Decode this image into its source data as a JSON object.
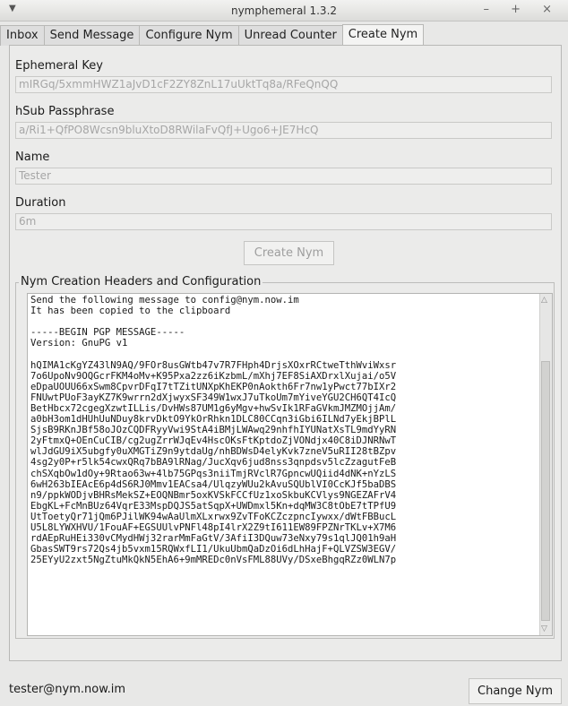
{
  "window": {
    "title": "nymphemeral 1.3.2",
    "menu_icon": "triangle-down-icon",
    "controls": "– + ×"
  },
  "tabs": [
    {
      "label": "Inbox",
      "active": false
    },
    {
      "label": "Send Message",
      "active": false
    },
    {
      "label": "Configure Nym",
      "active": false
    },
    {
      "label": "Unread Counter",
      "active": false
    },
    {
      "label": "Create Nym",
      "active": true
    }
  ],
  "form": {
    "ephemeral_key": {
      "label": "Ephemeral Key",
      "value": "mIRGq/5xmmHWZ1aJvD1cF2ZY8ZnL17uUktTq8a/RFeQnQQ"
    },
    "hsub_passphrase": {
      "label": "hSub Passphrase",
      "value": "a/Ri1+QfPO8Wcsn9bluXtoD8RWilaFvQfJ+Ugo6+JE7HcQ"
    },
    "name": {
      "label": "Name",
      "value": "Tester"
    },
    "duration": {
      "label": "Duration",
      "value": "6m"
    },
    "create_button": "Create Nym"
  },
  "output": {
    "group_title": "Nym Creation Headers and Configuration",
    "text": "Send the following message to config@nym.now.im\nIt has been copied to the clipboard\n\n-----BEGIN PGP MESSAGE-----\nVersion: GnuPG v1\n\nhQIMA1cKgYZ43lN9AQ/9FOr8usGWtb47v7R7FHph4DrjsXOxrRCtweTthWviWxsr\n7o6UpoNv9OQGcrFKM4oMv+K95Pxa2zz6iKzbmL/mXhj7EF8SiAXDrxlXujai/o5V\neDpaUOUU66xSwm8CpvrDFqI7tTZitUNXpKhEKP0nAokth6Fr7nw1yPwct77bIXr2\nFNUwtPUoF3ayKZ7K9wrrn2dXjwyxSF349W1wxJ7uTkoUm7mYiveYGU2CH6QT4IcQ\nBetHbcx72cgegXzwtILLis/DvHWs87UM1g6yMgv+hwSvIk1RFaGVkmJMZMOjjAm/\na0bH3om1dHUhUuNDuy8krvDktO9YkOrRhkn1DLC80CCqn3iGbi6ILNd7yEkjBPlL\nSjsB9RKnJBf58oJOzCQDFRyyVwi9StA4iBMjLWAwq29nhfhIYUNatXsTL9mdYyRN\n2yFtmxQ+OEnCuCIB/cg2ugZrrWJqEv4HscOKsFtKptdoZjVONdjx40C8iDJNRNwT\nwlJdGU9iX5ubgfy0uXMGTiZ9n9ytdaUg/nhBDWsD4elyKvk7zneV5uRII28tBZpv\n4sg2y0P+r5lk54cwxQRq7bBA9lRNag/JucXqv6jud8nss3qnpdsv5lcZzagutFeB\nchSXqbOw1dOy+9Rtao63w+4lb75GPqs3niiTmjRVclR7GpncwUQiid4dNK+nYzLS\n6wH263bIEAcE6p4dS6RJ0Mmv1EACsa4/UlqzyWUu2kAvuSQUblVI0CcKJf5baDBS\nn9/ppkWODjvBHRsMekSZ+EOQNBmr5oxKVSkFCCfUz1xoSkbuKCVlys9NGEZAFrV4\nEbgKL+FcMnBUz64VqrE33MspDQJS5atSqpX+UWDmxl5Kn+dqMW3C8tObE7tTPfU9\nUtToetyQr71jQm6PJilWK94wAaUlmXLxrwx9ZvTFoKCZczpncIywxx/dWtFBBucL\nU5L8LYWXHVU/1FouAF+EGSUUlvPNFl48pI4lrX2Z9tI611EW89FPZNrTKLv+X7M6\nrdAEpRuHEi330vCMydHWj32rarMmFaGtV/3AfiI3DQuw73eNxy79s1qlJQ01h9aH\nGbasSWT9rs72Qs4jb5vxm15RQWxfLI1/UkuUbmQaDzOi6dLhHajF+QLVZSW3EGV/\n25EYyU2zxt5NgZtuMkQkN5EhA6+9mMREDc0nVsFML88UVy/DSxeBhgqRZz0WLN7p"
  },
  "status_bar": {
    "nym": "tester@nym.now.im",
    "change_button": "Change Nym"
  }
}
